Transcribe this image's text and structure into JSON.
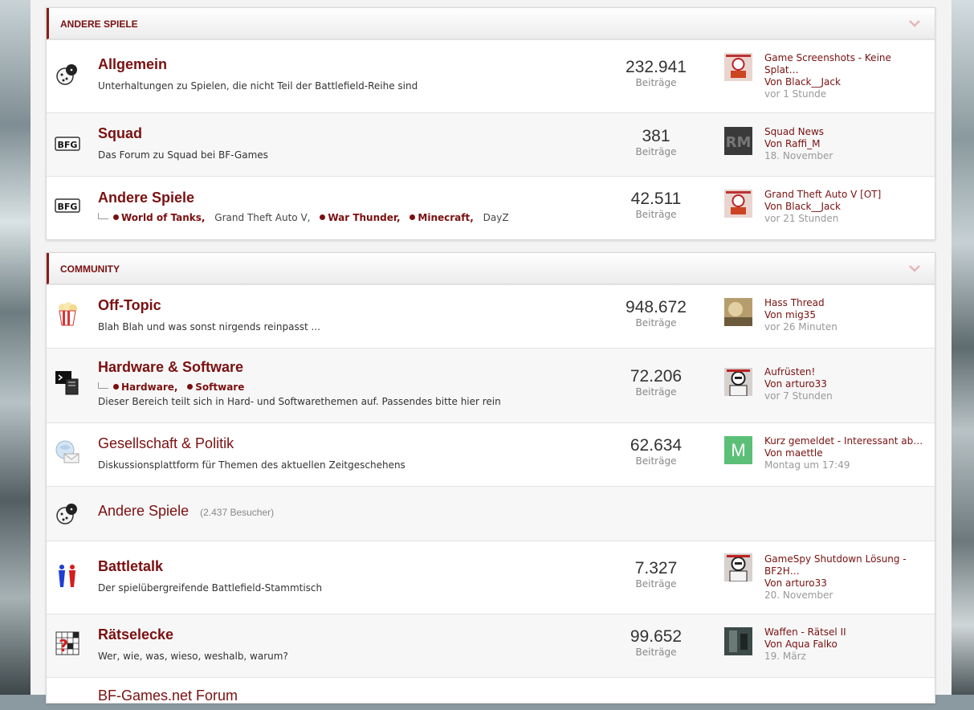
{
  "colors": {
    "accent": "#7a1010",
    "muted": "#888888"
  },
  "sections": [
    {
      "title": "ANDERE SPIELE",
      "forums": [
        {
          "icon": "dice-icon",
          "title": "Allgemein",
          "description": "Unterhaltungen zu Spielen, die nicht Teil der Battlefield-Reihe sind",
          "posts": "232.941",
          "posts_label": "Beiträge",
          "last_post": {
            "title": "Game Screenshots - Keine Splat…",
            "by": "Von Black__Jack",
            "time": "vor 1 Stunde"
          }
        },
        {
          "icon": "bfg-icon",
          "title": "Squad",
          "description": "Das Forum zu Squad bei BF-Games",
          "posts": "381",
          "posts_label": "Beiträge",
          "last_post": {
            "title": "Squad News",
            "by": "Von Raffi_M",
            "time": "18. November"
          }
        },
        {
          "icon": "bfg-icon",
          "title": "Andere Spiele",
          "subforums": [
            "World of Tanks,",
            "Grand Theft Auto V,",
            "War Thunder,",
            "Minecraft,",
            "DayZ"
          ],
          "posts": "42.511",
          "posts_label": "Beiträge",
          "last_post": {
            "title": "Grand Theft Auto V [OT]",
            "by": "Von Black__Jack",
            "time": "vor 21 Stunden"
          }
        }
      ]
    },
    {
      "title": "COMMUNITY",
      "forums": [
        {
          "icon": "popcorn-icon",
          "title": "Off-Topic",
          "description": "Blah Blah und was sonst nirgends reinpasst ...",
          "posts": "948.672",
          "posts_label": "Beiträge",
          "last_post": {
            "title": "Hass Thread",
            "by": "Von mig35",
            "time": "vor 26 Minuten"
          }
        },
        {
          "icon": "terminal-icon",
          "title": "Hardware & Software",
          "subforums": [
            "Hardware,",
            "Software"
          ],
          "description": "Dieser Bereich teilt sich in Hard- und Softwarethemen auf. Passendes bitte hier rein",
          "posts": "72.206",
          "posts_label": "Beiträge",
          "last_post": {
            "title": "Aufrüsten!",
            "by": "Von arturo33",
            "time": "vor 7 Stunden"
          }
        },
        {
          "icon": "globe-mail-icon",
          "title": "Gesellschaft & Politik",
          "description": "Diskussionsplattform für Themen des aktuellen Zeitgeschehens",
          "posts": "62.634",
          "posts_label": "Beiträge",
          "last_post": {
            "title": "Kurz gemeldet - Interessant ab…",
            "by": "Von maettle",
            "time": "Montag um 17:49",
            "avatar_letter": "M"
          }
        },
        {
          "icon": "dice-icon",
          "title": "Andere Spiele",
          "visitors": "(2.437 Besucher)"
        },
        {
          "icon": "people-icon",
          "title": "Battletalk",
          "description": "Der spielübergreifende Battlefield-Stammtisch",
          "posts": "7.327",
          "posts_label": "Beiträge",
          "last_post": {
            "title": "GameSpy Shutdown Lösung - BF2H…",
            "by": "Von arturo33",
            "time": "20. November"
          }
        },
        {
          "icon": "crossword-icon",
          "title": "Rätselecke",
          "description": "Wer, wie, was, wieso, weshalb, warum?",
          "posts": "99.652",
          "posts_label": "Beiträge",
          "last_post": {
            "title": "Waffen - Rätsel II",
            "by": "Von Aqua Falko",
            "time": "19. März"
          }
        },
        {
          "icon": "forum-icon",
          "title": "BF-Games.net Forum"
        }
      ]
    }
  ]
}
